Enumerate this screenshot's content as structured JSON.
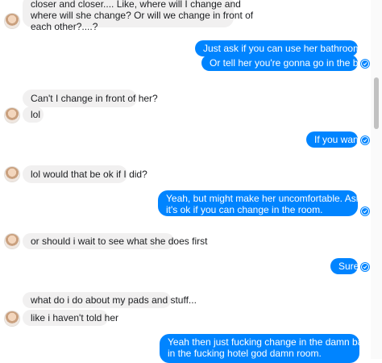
{
  "messages": [
    {
      "side": "in",
      "lines": [
        "closer and closer.... Like, where will I change and",
        "where will she change? Or will we change in front of",
        "each other?....?"
      ]
    },
    {
      "side": "out",
      "lines": [
        "Just ask if you can use her bathroom quickly"
      ]
    },
    {
      "side": "out",
      "lines": [
        "Or tell her you're gonna go in the bathroom"
      ]
    },
    {
      "side": "in",
      "lines": [
        "Can't I change in front of her?"
      ]
    },
    {
      "side": "in",
      "lines": [
        "lol"
      ]
    },
    {
      "side": "out",
      "lines": [
        "If you want?"
      ]
    },
    {
      "side": "in",
      "lines": [
        "lol would that be ok if I did?"
      ]
    },
    {
      "side": "out",
      "lines": [
        "Yeah, but might make her uncomfortable. Ask her if",
        "it's ok if you can change in the room."
      ]
    },
    {
      "side": "in",
      "lines": [
        "or should i wait to see what she does first"
      ]
    },
    {
      "side": "out",
      "lines": [
        "Sure"
      ]
    },
    {
      "side": "in",
      "lines": [
        "what do i do about my pads and stuff..."
      ]
    },
    {
      "side": "in",
      "lines": [
        "like i haven't told her"
      ]
    },
    {
      "side": "out",
      "lines": [
        "Yeah then just fucking change in the damn bathroom",
        "in the fucking hotel god damn room."
      ]
    }
  ],
  "colors": {
    "outgoing": "#0084ff",
    "incoming": "#f1f0f0"
  },
  "icons": {
    "avatar": "contact-avatar",
    "seen": "seen-check-icon"
  }
}
